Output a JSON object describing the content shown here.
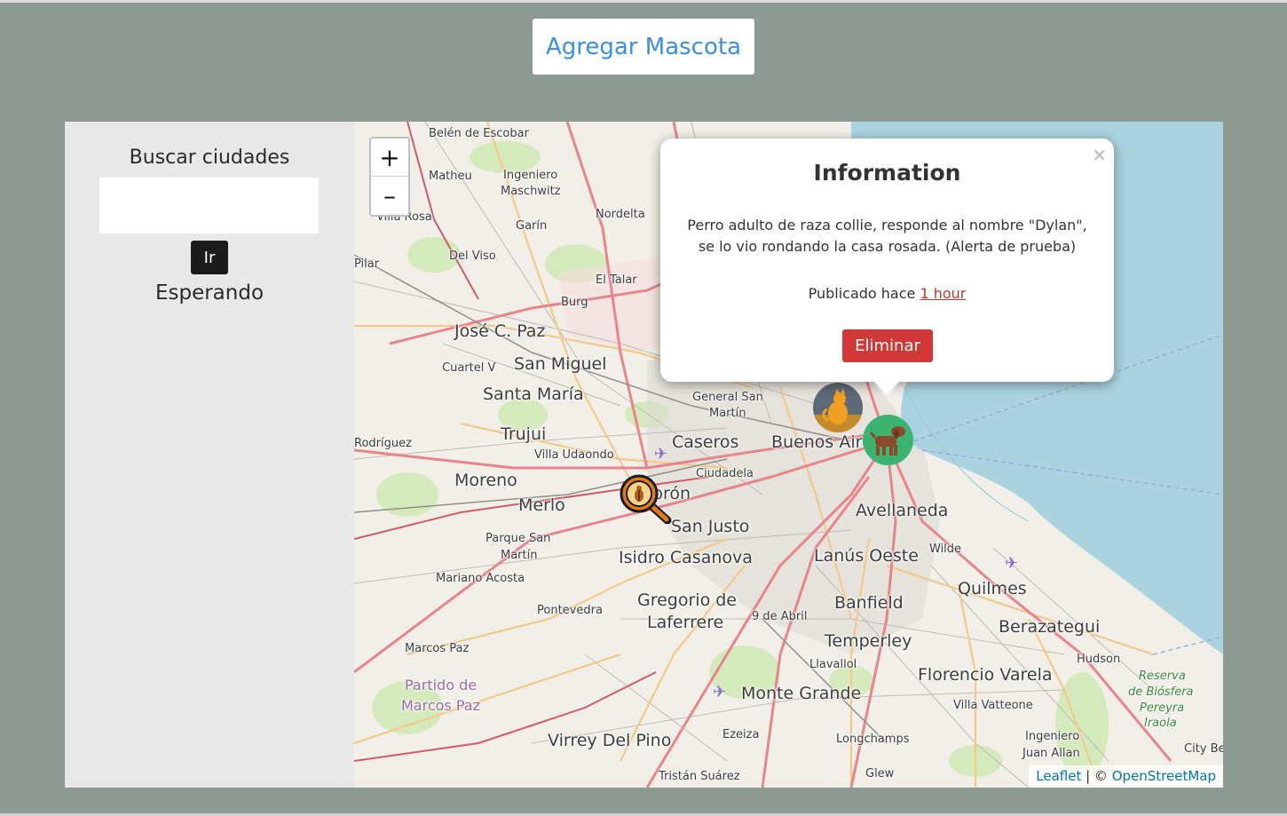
{
  "header": {
    "add_button_label": "Agregar Mascota"
  },
  "sidebar": {
    "title": "Buscar ciudades",
    "search_value": "",
    "go_button_label": "Ir",
    "status": "Esperando"
  },
  "map": {
    "zoom_in_label": "+",
    "zoom_out_label": "–",
    "place_labels": [
      "Belén de Escobar",
      "Matheu",
      "Ingeniero",
      "Maschwitz",
      "Villa Rosa",
      "Garín",
      "Nordelta",
      "Pilar",
      "Del Viso",
      "El Talar",
      "Burg",
      "José C. Paz",
      "Cuartel V",
      "San Miguel",
      "Santa María",
      "General San",
      "Martín",
      "Trujui",
      "Caseros",
      "Buenos Aires",
      "Villa Udaondo",
      "Ciudadela",
      "Moreno",
      "Merlo",
      "Morón",
      "San Justo",
      "Avellaneda",
      "Parque San",
      "Martín",
      "Isidro Casanova",
      "Lanús Oeste",
      "Wilde",
      "Mariano Acosta",
      "Quilmes",
      "Gregorio de",
      "Laferrere",
      "Pontevedra",
      "9 de Abril",
      "Banfield",
      "Berazategui",
      "Temperley",
      "Marcos Paz",
      "Llavallol",
      "Hudson",
      "Partido de",
      "Marcos Paz",
      "Florencio Varela",
      "Monte Grande",
      "Villa Vatteone",
      "Reserva",
      "de Biósfera",
      "Pereyra",
      "Iraola",
      "Ezeiza",
      "Virrey Del Pino",
      "Longchamps",
      "Ingeniero",
      "Juan Allan",
      "City Be",
      "Glew",
      "Tristán Suárez",
      "Rodríguez"
    ],
    "markers": [
      {
        "name": "cat-marker-icon",
        "color": "#d99a1e"
      },
      {
        "name": "dog-marker-icon",
        "color": "#3cb371"
      },
      {
        "name": "search-bug-marker-icon",
        "color": "#e07a1f"
      }
    ]
  },
  "popup": {
    "title": "Information",
    "description": "Perro adulto de raza collie, responde al nombre \"Dylan\", se lo vio rondando la casa rosada. (Alerta de prueba)",
    "posted_prefix": "Publicado hace",
    "posted_time": "1 hour",
    "delete_button_label": "Eliminar",
    "close_label": "×"
  },
  "attribution": {
    "leaflet": "Leaflet",
    "separator": " | © ",
    "osm": "OpenStreetMap"
  },
  "colors": {
    "page_bg": "#8c9a93",
    "sidebar_bg": "#e7e8e7",
    "accent_link": "#3a8ee6",
    "danger": "#d33838",
    "water": "#aad3df"
  }
}
